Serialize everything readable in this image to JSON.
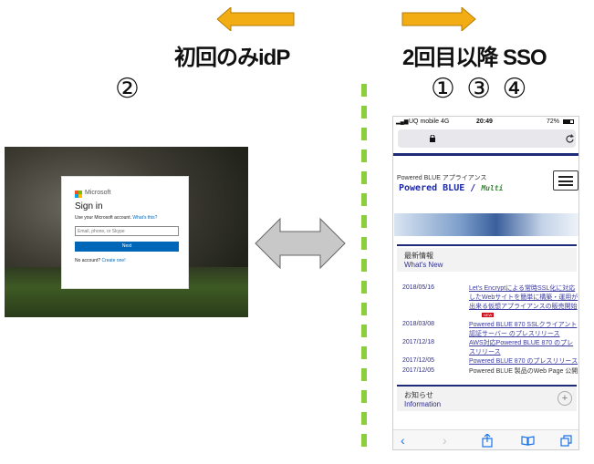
{
  "arrows": {
    "left_color": "#f3ad14",
    "right_color": "#f3ad14",
    "double_color": "#c8c8c8"
  },
  "labels": {
    "left_heading": "初回のみidP",
    "right_heading": "2回目以降 SSO",
    "left_step": "②",
    "right_steps": "① ③ ④"
  },
  "divider_color": "#8ccf3c",
  "signin": {
    "brand": "Microsoft",
    "title": "Sign in",
    "prompt": "Use your Microsoft account.",
    "prompt_link": "What's this?",
    "email_placeholder": "Email, phone, or Skype",
    "next_label": "Next",
    "no_account": "No account?",
    "create_link": "Create one!"
  },
  "phone": {
    "carrier": "UQ mobile  4G",
    "time": "20:49",
    "battery": "72%",
    "lock_icon": "lock-icon",
    "tagline": "Powered BLUE アプライアンス",
    "logo_main": "Powered BLUE /",
    "logo_sub": "Multi",
    "section_jp": "最新情報",
    "section_en": "What's New",
    "news": [
      {
        "date": "2018/05/16",
        "title": "Let's Encryptによる常時SSL化に対応したWebサイトを簡単に構築・運用が出来る仮想アプライアンスの販売開始",
        "badge": "NEW"
      },
      {
        "date": "2018/03/08",
        "title": "Powered BLUE 870 SSLクライアント認証サーバー のプレスリリース",
        "badge": ""
      },
      {
        "date": "2017/12/18",
        "title": "AWS対応Powered BLUE 870 のプレスリリース",
        "badge": ""
      },
      {
        "date": "2017/12/05",
        "title": "Powered BLUE 870 のプレスリリース",
        "badge": ""
      },
      {
        "date": "2017/12/05",
        "title": "Powered BLUE 製品のWeb Page 公開",
        "badge": ""
      }
    ],
    "notice_jp": "お知らせ",
    "notice_en": "Information"
  }
}
